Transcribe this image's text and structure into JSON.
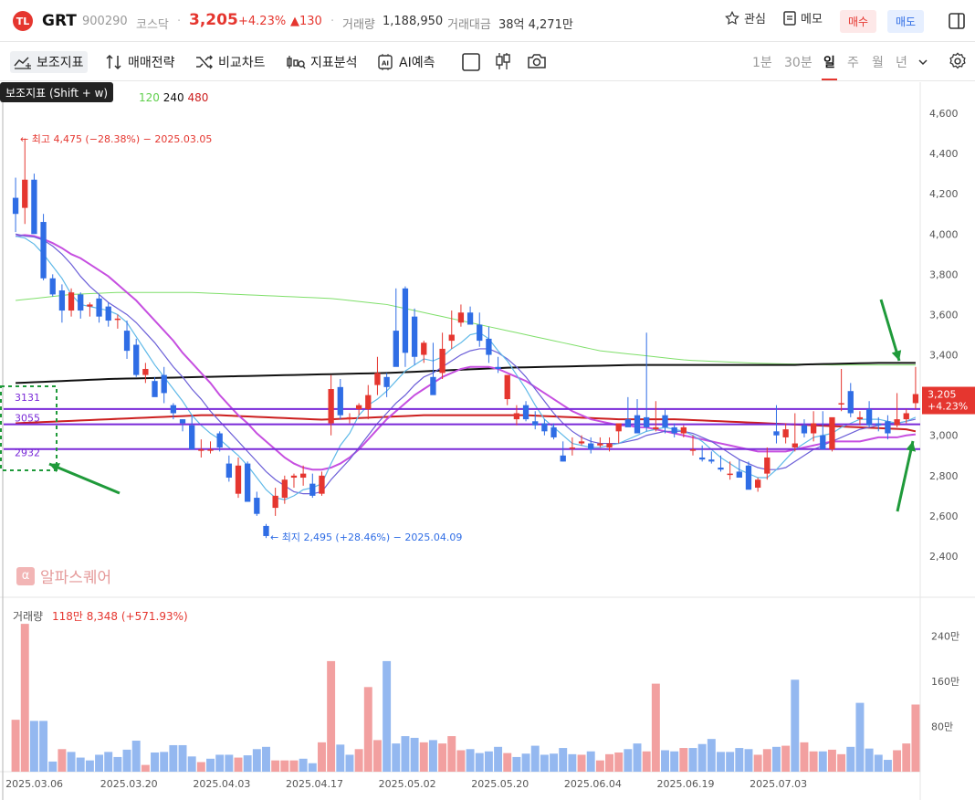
{
  "header": {
    "name": "GRT",
    "code": "900290",
    "market": "코스닥",
    "price": "3,205",
    "change_pct": "+4.23%",
    "change_amt": "▲130",
    "volume_label": "거래량",
    "volume_value": "1,188,950",
    "amount_label": "거래대금",
    "amount_value": "38억 4,271만",
    "watch_label": "관심",
    "memo_label": "메모",
    "buy_label": "매수",
    "sell_label": "매도"
  },
  "toolbar": {
    "indicator_label": "보조지표",
    "strategy_label": "매매전략",
    "compare_label": "비교차트",
    "analysis_label": "지표분석",
    "ai_label": "AI예측",
    "periods": [
      "1분",
      "30분",
      "일",
      "주",
      "월",
      "년"
    ],
    "selected_period": "일"
  },
  "tooltip": "보조지표 (Shift + w)",
  "ma_legend": [
    "120",
    "240",
    "480"
  ],
  "colors": {
    "up": "#e5362f",
    "down": "#2f6de5",
    "up_vol": "#f2a0a0",
    "down_vol": "#94b8f0",
    "ma5": "#5fb9e8",
    "ma10": "#6c5fd8",
    "ma20": "#c64fe0",
    "ma60": "#cc1f1f",
    "ma120": "#7fdf6a",
    "ma240": "#111111",
    "hline": "#7a2ad8",
    "annotation": "#1f9a3a"
  },
  "chart_data": {
    "type": "candlestick",
    "x_ticks": [
      "2025.03.06",
      "2025.03.20",
      "2025.04.03",
      "2025.04.17",
      "2025.05.02",
      "2025.05.20",
      "2025.06.04",
      "2025.06.19",
      "2025.07.03"
    ],
    "x_tick_index": [
      0,
      10,
      20,
      30,
      40,
      50,
      60,
      70,
      80
    ],
    "y_ticks": [
      "4,600",
      "4,400",
      "4,200",
      "4,000",
      "3,800",
      "3,600",
      "3,400",
      "3,200",
      "3,000",
      "2,800",
      "2,600",
      "2,400"
    ],
    "ylim": [
      2400,
      4600
    ],
    "high_label": "최고 4,475 (−28.38%) − 2025.03.05",
    "low_label": "최지 2,495 (+28.46%) − 2025.04.09",
    "last_price_tag": "3,205",
    "last_change_tag": "+4.23%",
    "h_levels": [
      {
        "label": "3131",
        "value": 3131
      },
      {
        "label": "3055",
        "value": 3055
      },
      {
        "label": "2932",
        "value": 2932
      }
    ],
    "candles": [
      [
        4180,
        4280,
        4010,
        4100
      ],
      [
        4130,
        4475,
        4050,
        4270
      ],
      [
        4270,
        4300,
        4070,
        4000
      ],
      [
        4060,
        4100,
        3770,
        3780
      ],
      [
        3780,
        3800,
        3690,
        3700
      ],
      [
        3720,
        3750,
        3560,
        3620
      ],
      [
        3620,
        3730,
        3590,
        3710
      ],
      [
        3700,
        3710,
        3580,
        3620
      ],
      [
        3640,
        3660,
        3590,
        3650
      ],
      [
        3680,
        3700,
        3560,
        3590
      ],
      [
        3640,
        3660,
        3540,
        3570
      ],
      [
        3580,
        3600,
        3530,
        3580
      ],
      [
        3520,
        3570,
        3380,
        3420
      ],
      [
        3450,
        3480,
        3290,
        3300
      ],
      [
        3300,
        3360,
        3260,
        3330
      ],
      [
        3270,
        3290,
        3210,
        3190
      ],
      [
        3300,
        3340,
        3160,
        3210
      ],
      [
        3150,
        3160,
        3080,
        3110
      ],
      [
        3080,
        3080,
        3020,
        3060
      ],
      [
        3050,
        3100,
        2960,
        2930
      ],
      [
        2930,
        2980,
        2890,
        2930
      ],
      [
        2930,
        2970,
        2910,
        2930
      ],
      [
        3010,
        3020,
        2920,
        2940
      ],
      [
        2860,
        2900,
        2770,
        2790
      ],
      [
        2710,
        2890,
        2690,
        2850
      ],
      [
        2860,
        2870,
        2700,
        2670
      ],
      [
        2690,
        2720,
        2600,
        2610
      ],
      [
        2550,
        2560,
        2490,
        2500
      ],
      [
        2640,
        2740,
        2600,
        2700
      ],
      [
        2690,
        2800,
        2660,
        2780
      ],
      [
        2790,
        2810,
        2740,
        2800
      ],
      [
        2790,
        2850,
        2750,
        2810
      ],
      [
        2760,
        2810,
        2690,
        2700
      ],
      [
        2710,
        2820,
        2700,
        2800
      ],
      [
        3060,
        3300,
        3000,
        3230
      ],
      [
        3240,
        3280,
        3080,
        3100
      ],
      [
        3080,
        3110,
        3060,
        3090
      ],
      [
        3130,
        3160,
        3100,
        3150
      ],
      [
        3130,
        3250,
        3080,
        3200
      ],
      [
        3250,
        3390,
        3200,
        3310
      ],
      [
        3290,
        3310,
        3190,
        3240
      ],
      [
        3520,
        3730,
        3400,
        3340
      ],
      [
        3730,
        3740,
        3340,
        3410
      ],
      [
        3590,
        3630,
        3350,
        3390
      ],
      [
        3400,
        3470,
        3360,
        3460
      ],
      [
        3290,
        3460,
        3230,
        3200
      ],
      [
        3310,
        3510,
        3280,
        3430
      ],
      [
        3470,
        3620,
        3430,
        3500
      ],
      [
        3560,
        3650,
        3540,
        3610
      ],
      [
        3610,
        3640,
        3570,
        3550
      ],
      [
        3550,
        3610,
        3440,
        3470
      ],
      [
        3480,
        3540,
        3360,
        3400
      ],
      [
        3340,
        3390,
        3310,
        3330
      ],
      [
        3180,
        3290,
        3150,
        3300
      ],
      [
        3080,
        3150,
        3050,
        3110
      ],
      [
        3150,
        3170,
        3070,
        3080
      ],
      [
        3070,
        3120,
        3030,
        3050
      ],
      [
        3060,
        3080,
        3000,
        3020
      ],
      [
        3040,
        3060,
        2980,
        2990
      ],
      [
        2900,
        2970,
        2870,
        2870
      ],
      [
        2940,
        2990,
        2900,
        2940
      ],
      [
        2960,
        3000,
        2950,
        2970
      ],
      [
        2960,
        2990,
        2910,
        2930
      ],
      [
        2950,
        2990,
        2940,
        2960
      ],
      [
        2940,
        2990,
        2920,
        2960
      ],
      [
        3020,
        3050,
        2960,
        3060
      ],
      [
        3080,
        3190,
        3050,
        3040
      ],
      [
        3100,
        3180,
        3070,
        3010
      ],
      [
        3090,
        3510,
        3020,
        3040
      ],
      [
        3030,
        3170,
        3020,
        3040
      ],
      [
        3100,
        3130,
        3010,
        3040
      ],
      [
        3040,
        3060,
        2990,
        3010
      ],
      [
        3010,
        3050,
        2990,
        3040
      ],
      [
        2930,
        3000,
        2900,
        2930
      ],
      [
        2890,
        2950,
        2870,
        2880
      ],
      [
        2880,
        2920,
        2860,
        2870
      ],
      [
        2840,
        2900,
        2820,
        2830
      ],
      [
        2810,
        2870,
        2780,
        2810
      ],
      [
        2820,
        2880,
        2790,
        2790
      ],
      [
        2850,
        2870,
        2740,
        2730
      ],
      [
        2740,
        2790,
        2720,
        2780
      ],
      [
        2810,
        2940,
        2780,
        2890
      ],
      [
        3020,
        3150,
        2960,
        3000
      ],
      [
        2990,
        3060,
        2960,
        3030
      ],
      [
        2940,
        3110,
        2920,
        2960
      ],
      [
        3050,
        3080,
        2990,
        3010
      ],
      [
        3010,
        3120,
        2970,
        3060
      ],
      [
        3000,
        3120,
        2980,
        2930
      ],
      [
        2930,
        3040,
        2920,
        3090
      ],
      [
        3160,
        3330,
        3120,
        3160
      ],
      [
        3220,
        3260,
        3090,
        3110
      ],
      [
        3080,
        3120,
        3050,
        3090
      ],
      [
        3130,
        3170,
        3040,
        3050
      ],
      [
        3060,
        3090,
        3020,
        3050
      ],
      [
        3070,
        3100,
        2980,
        3010
      ],
      [
        3050,
        3210,
        3040,
        3080
      ],
      [
        3080,
        3130,
        3060,
        3110
      ],
      [
        3160,
        3340,
        3130,
        3205
      ]
    ],
    "ma5": [
      3990,
      3980,
      3950,
      3900,
      3840,
      3780,
      3700,
      3650,
      3640,
      3630,
      3620,
      3600,
      3560,
      3490,
      3420,
      3350,
      3290,
      3230,
      3170,
      3100,
      3050,
      3010,
      2980,
      2940,
      2900,
      2850,
      2790,
      2730,
      2690,
      2680,
      2700,
      2730,
      2740,
      2760,
      2860,
      2950,
      3010,
      3100,
      3150,
      3180,
      3220,
      3270,
      3320,
      3350,
      3380,
      3370,
      3390,
      3430,
      3460,
      3500,
      3510,
      3480,
      3420,
      3370,
      3300,
      3230,
      3150,
      3080,
      3040,
      3000,
      2960,
      2950,
      2940,
      2940,
      2950,
      2960,
      2980,
      3000,
      3020,
      3030,
      3040,
      3030,
      3020,
      3000,
      2970,
      2930,
      2890,
      2860,
      2830,
      2810,
      2790,
      2790,
      2830,
      2880,
      2930,
      2960,
      2990,
      3000,
      3010,
      3040,
      3060,
      3080,
      3080,
      3080,
      3070,
      3060,
      3070,
      3090
    ],
    "ma10": [
      4000,
      3990,
      3985,
      3970,
      3940,
      3900,
      3850,
      3790,
      3740,
      3700,
      3660,
      3630,
      3600,
      3560,
      3510,
      3460,
      3400,
      3340,
      3290,
      3230,
      3180,
      3120,
      3070,
      3020,
      2970,
      2920,
      2870,
      2820,
      2780,
      2750,
      2720,
      2710,
      2710,
      2720,
      2780,
      2830,
      2880,
      2940,
      3000,
      3060,
      3110,
      3160,
      3200,
      3250,
      3290,
      3310,
      3340,
      3370,
      3400,
      3420,
      3430,
      3430,
      3410,
      3380,
      3340,
      3290,
      3230,
      3170,
      3110,
      3060,
      3020,
      2990,
      2970,
      2960,
      2960,
      2960,
      2970,
      2980,
      3000,
      3010,
      3020,
      3020,
      3020,
      3010,
      2990,
      2970,
      2940,
      2910,
      2880,
      2860,
      2840,
      2830,
      2830,
      2840,
      2870,
      2900,
      2930,
      2950,
      2970,
      2990,
      3010,
      3030,
      3040,
      3050,
      3060,
      3060,
      3070,
      3080
    ],
    "ma20": [
      3990,
      3995,
      3990,
      3975,
      3955,
      3930,
      3900,
      3880,
      3850,
      3820,
      3790,
      3750,
      3710,
      3670,
      3620,
      3570,
      3520,
      3470,
      3410,
      3360,
      3310,
      3260,
      3200,
      3150,
      3100,
      3060,
      3010,
      2970,
      2930,
      2890,
      2860,
      2840,
      2830,
      2830,
      2840,
      2860,
      2890,
      2930,
      2980,
      3030,
      3080,
      3120,
      3160,
      3200,
      3230,
      3260,
      3290,
      3310,
      3330,
      3340,
      3340,
      3340,
      3330,
      3310,
      3290,
      3270,
      3240,
      3210,
      3180,
      3150,
      3120,
      3100,
      3080,
      3070,
      3060,
      3050,
      3050,
      3040,
      3040,
      3030,
      3020,
      3010,
      3000,
      2990,
      2980,
      2970,
      2960,
      2950,
      2940,
      2930,
      2920,
      2920,
      2920,
      2920,
      2930,
      2940,
      2950,
      2960,
      2970,
      2970,
      2970,
      2970,
      2980,
      2990,
      2990,
      2990,
      3000,
      3005
    ],
    "ma60": [
      3060,
      3062,
      3064,
      3066,
      3068,
      3070,
      3072,
      3074,
      3076,
      3078,
      3080,
      3082,
      3084,
      3086,
      3088,
      3090,
      3092,
      3094,
      3096,
      3098,
      3100,
      3100,
      3100,
      3098,
      3096,
      3094,
      3092,
      3090,
      3088,
      3086,
      3084,
      3082,
      3080,
      3078,
      3080,
      3082,
      3084,
      3086,
      3088,
      3090,
      3092,
      3094,
      3096,
      3098,
      3100,
      3100,
      3100,
      3100,
      3100,
      3100,
      3100,
      3100,
      3100,
      3100,
      3100,
      3100,
      3098,
      3096,
      3094,
      3092,
      3090,
      3088,
      3086,
      3084,
      3082,
      3080,
      3080,
      3080,
      3080,
      3080,
      3080,
      3080,
      3078,
      3076,
      3074,
      3072,
      3070,
      3068,
      3066,
      3064,
      3062,
      3060,
      3058,
      3056,
      3054,
      3052,
      3050,
      3048,
      3046,
      3044,
      3042,
      3040,
      3038,
      3036,
      3034,
      3032,
      3030,
      3020
    ],
    "ma120": [
      3670,
      3675,
      3680,
      3685,
      3690,
      3695,
      3700,
      3702,
      3704,
      3706,
      3708,
      3710,
      3710,
      3710,
      3710,
      3710,
      3710,
      3710,
      3710,
      3710,
      3708,
      3706,
      3704,
      3702,
      3700,
      3698,
      3696,
      3694,
      3692,
      3690,
      3688,
      3686,
      3684,
      3682,
      3680,
      3675,
      3670,
      3665,
      3660,
      3655,
      3650,
      3640,
      3630,
      3620,
      3610,
      3600,
      3590,
      3580,
      3570,
      3560,
      3550,
      3540,
      3530,
      3520,
      3510,
      3500,
      3490,
      3480,
      3470,
      3460,
      3450,
      3440,
      3430,
      3420,
      3415,
      3410,
      3405,
      3400,
      3395,
      3390,
      3385,
      3380,
      3375,
      3372,
      3370,
      3368,
      3366,
      3364,
      3362,
      3360,
      3358,
      3357,
      3356,
      3355,
      3354,
      3353,
      3352,
      3351,
      3350,
      3350,
      3350,
      3350,
      3350,
      3350,
      3350,
      3350,
      3350,
      3350
    ],
    "ma240": [
      3260,
      3262,
      3264,
      3266,
      3268,
      3270,
      3272,
      3274,
      3276,
      3278,
      3280,
      3281,
      3282,
      3283,
      3284,
      3285,
      3286,
      3287,
      3288,
      3289,
      3290,
      3291,
      3292,
      3293,
      3294,
      3295,
      3296,
      3297,
      3298,
      3299,
      3300,
      3301,
      3302,
      3303,
      3304,
      3305,
      3306,
      3307,
      3308,
      3309,
      3310,
      3312,
      3314,
      3316,
      3318,
      3320,
      3322,
      3324,
      3326,
      3328,
      3330,
      3332,
      3334,
      3336,
      3337,
      3338,
      3339,
      3340,
      3341,
      3342,
      3343,
      3344,
      3345,
      3346,
      3347,
      3348,
      3349,
      3350,
      3350,
      3350,
      3350,
      3350,
      3350,
      3350,
      3350,
      3350,
      3350,
      3350,
      3350,
      3350,
      3350,
      3350,
      3350,
      3350,
      3350,
      3352,
      3353,
      3354,
      3355,
      3356,
      3357,
      3358,
      3359,
      3360,
      3360,
      3360,
      3360,
      3360
    ],
    "volume_label": "거래량",
    "volume_value_label": "118만 8,348 (+571.93%)",
    "volume_y_ticks": [
      "240만",
      "160만",
      "80만"
    ],
    "volume_ylim": [
      0,
      2800000
    ],
    "volumes": [
      920000,
      2620000,
      900000,
      900000,
      180000,
      400000,
      350000,
      250000,
      200000,
      300000,
      350000,
      260000,
      390000,
      550000,
      120000,
      340000,
      350000,
      470000,
      470000,
      270000,
      170000,
      230000,
      300000,
      300000,
      250000,
      290000,
      400000,
      440000,
      200000,
      200000,
      200000,
      230000,
      150000,
      520000,
      1960000,
      480000,
      300000,
      400000,
      1500000,
      560000,
      1960000,
      500000,
      630000,
      600000,
      520000,
      560000,
      500000,
      630000,
      380000,
      400000,
      330000,
      360000,
      440000,
      330000,
      260000,
      320000,
      460000,
      300000,
      320000,
      420000,
      310000,
      300000,
      360000,
      200000,
      310000,
      340000,
      400000,
      500000,
      360000,
      1560000,
      380000,
      360000,
      420000,
      420000,
      490000,
      580000,
      350000,
      350000,
      420000,
      400000,
      300000,
      400000,
      440000,
      460000,
      1630000,
      520000,
      360000,
      360000,
      390000,
      310000,
      440000,
      1220000,
      410000,
      300000,
      210000,
      380000,
      500000,
      1190000
    ],
    "volume_up": [
      true,
      true,
      false,
      false,
      false,
      true,
      false,
      false,
      false,
      false,
      false,
      false,
      false,
      false,
      true,
      false,
      false,
      false,
      false,
      false,
      true,
      false,
      false,
      false,
      true,
      false,
      false,
      false,
      true,
      true,
      true,
      false,
      false,
      true,
      true,
      false,
      false,
      true,
      true,
      true,
      false,
      false,
      false,
      false,
      true,
      false,
      true,
      true,
      true,
      false,
      false,
      false,
      false,
      true,
      false,
      false,
      false,
      false,
      false,
      false,
      false,
      true,
      false,
      true,
      true,
      true,
      false,
      false,
      true,
      true,
      false,
      false,
      true,
      false,
      false,
      false,
      false,
      false,
      false,
      false,
      true,
      true,
      false,
      true,
      false,
      true,
      true,
      false,
      true,
      true,
      false,
      false,
      false,
      false,
      false,
      true,
      true,
      true
    ]
  }
}
